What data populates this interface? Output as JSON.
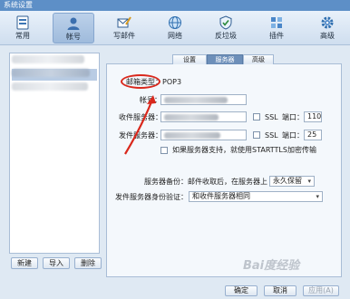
{
  "window": {
    "title": "系统设置"
  },
  "toolbar": {
    "items": [
      {
        "label": "常用"
      },
      {
        "label": "帐号"
      },
      {
        "label": "写邮件"
      },
      {
        "label": "网络"
      },
      {
        "label": "反垃圾"
      },
      {
        "label": "插件"
      },
      {
        "label": "高级"
      }
    ],
    "active": "帐号"
  },
  "accounts": {
    "buttons": {
      "new": "新建",
      "import": "导入",
      "delete": "删除"
    }
  },
  "tabs": [
    {
      "label": "设置"
    },
    {
      "label": "服务器"
    },
    {
      "label": "高级"
    }
  ],
  "server": {
    "mail_type": "邮箱类型：POP3",
    "account_label": "帐号：",
    "incoming_label": "收件服务器：",
    "outgoing_label": "发件服务器：",
    "ssl_label": "SSL",
    "port_label": "端口：",
    "incoming_port": "110",
    "outgoing_port": "25",
    "starttls_label": "如果服务器支持，就使用STARTTLS加密传输",
    "backup_label": "服务器备份：",
    "backup_text": "邮件收取后，在服务器上",
    "backup_value": "永久保留",
    "auth_label": "发件服务器身份验证：",
    "auth_value": "和收件服务器相同"
  },
  "footer": {
    "ok": "确定",
    "cancel": "取消",
    "apply": "应用(A)"
  },
  "watermark": "Bai度经验",
  "colors": {
    "annotation": "#d9281c",
    "accent": "#5d8fc7"
  }
}
